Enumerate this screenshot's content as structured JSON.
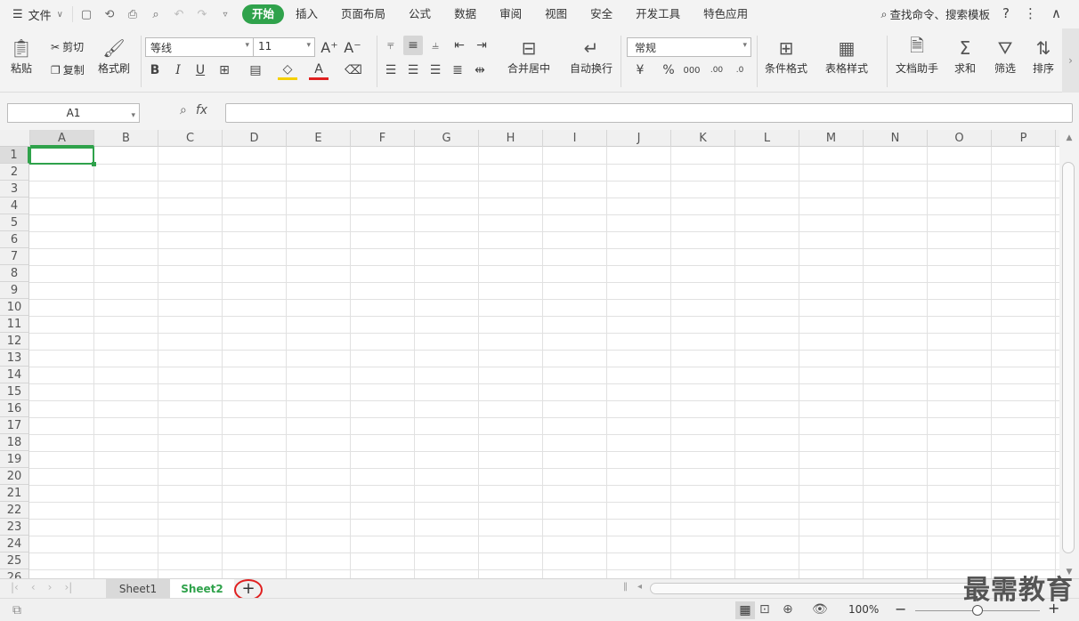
{
  "menubar": {
    "file_label": "文件",
    "tabs": [
      "开始",
      "插入",
      "页面布局",
      "公式",
      "数据",
      "审阅",
      "视图",
      "安全",
      "开发工具",
      "特色应用"
    ],
    "search_label": "查找命令、搜索模板"
  },
  "ribbon": {
    "paste": "粘贴",
    "cut": "剪切",
    "copy": "复制",
    "format_painter": "格式刷",
    "font_name": "等线",
    "font_size": "11",
    "merge_center": "合并居中",
    "wrap_text": "自动换行",
    "number_format": "常规",
    "conditional_format": "条件格式",
    "table_style": "表格样式",
    "doc_helper": "文档助手",
    "sum": "求和",
    "filter": "筛选",
    "sort": "排序"
  },
  "formula_bar": {
    "name_box": "A1",
    "fx": "fx",
    "value": ""
  },
  "columns": [
    "A",
    "B",
    "C",
    "D",
    "E",
    "F",
    "G",
    "H",
    "I",
    "J",
    "K",
    "L",
    "M",
    "N",
    "O",
    "P"
  ],
  "rows": [
    "1",
    "2",
    "3",
    "4",
    "5",
    "6",
    "7",
    "8",
    "9",
    "10",
    "11",
    "12",
    "13",
    "14",
    "15",
    "16",
    "17",
    "18",
    "19",
    "20",
    "21",
    "22",
    "23",
    "24",
    "25",
    "26"
  ],
  "sheets": [
    "Sheet1",
    "Sheet2"
  ],
  "active_sheet": "Sheet2",
  "status": {
    "zoom": "100%"
  },
  "watermark": "最需教育",
  "colors": {
    "accent": "#2fa24b",
    "highlight_circle": "#e02020"
  }
}
